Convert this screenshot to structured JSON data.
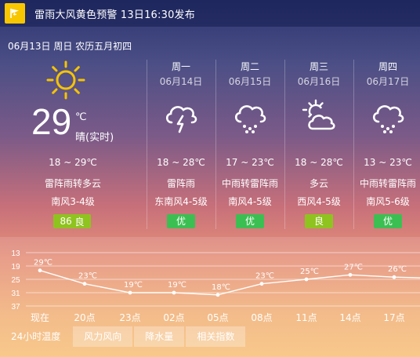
{
  "alert": {
    "icon": "warning-flag-icon",
    "text": "雷雨大风黄色预警 13日16:30发布",
    "color": "#f7c600"
  },
  "today": {
    "date_line": "06月13日 周日 农历五月初四",
    "icon": "sun-icon",
    "temp": "29",
    "unit": "℃",
    "live_label": "晴(实时)",
    "range": "18 ~ 29℃",
    "weather": "雷阵雨转多云",
    "wind": "南风3-4级",
    "aqi_value": "86",
    "aqi_label": "良",
    "aqi_color": "#8fc31f"
  },
  "days": [
    {
      "weekday": "周一",
      "date": "06月14日",
      "icon": "thunder-cloud-icon",
      "range": "18 ~ 28℃",
      "weather": "雷阵雨",
      "wind": "东南风4-5级",
      "aqi": "优",
      "aqi_color": "#3cbf52"
    },
    {
      "weekday": "周二",
      "date": "06月15日",
      "icon": "rain-cloud-icon",
      "range": "17 ~ 23℃",
      "weather": "中雨转雷阵雨",
      "wind": "南风4-5级",
      "aqi": "优",
      "aqi_color": "#3cbf52"
    },
    {
      "weekday": "周三",
      "date": "06月16日",
      "icon": "sun-cloud-icon",
      "range": "18 ~ 28℃",
      "weather": "多云",
      "wind": "西风4-5级",
      "aqi": "良",
      "aqi_color": "#8fc31f"
    },
    {
      "weekday": "周四",
      "date": "06月17日",
      "icon": "rain-cloud-icon",
      "range": "13 ~ 23℃",
      "weather": "中雨转雷阵雨",
      "wind": "南风5-6级",
      "aqi": "优",
      "aqi_color": "#3cbf52"
    }
  ],
  "chart_data": {
    "type": "line",
    "categories": [
      "现在",
      "20点",
      "23点",
      "02点",
      "05点",
      "08点",
      "11点",
      "14点",
      "17点"
    ],
    "values": [
      29,
      23,
      19,
      19,
      18,
      23,
      25,
      27,
      26
    ],
    "value_labels": [
      "29℃",
      "23℃",
      "19℃",
      "19℃",
      "18℃",
      "23℃",
      "25℃",
      "27℃",
      "26℃"
    ],
    "ytick_labels": [
      "37",
      "31",
      "25",
      "19",
      "13"
    ],
    "ylim": [
      13,
      37
    ],
    "yticks": [
      13,
      19,
      25,
      31,
      37
    ],
    "grid": true
  },
  "tabs": [
    "24小时温度",
    "风力风向",
    "降水量",
    "相关指数"
  ]
}
